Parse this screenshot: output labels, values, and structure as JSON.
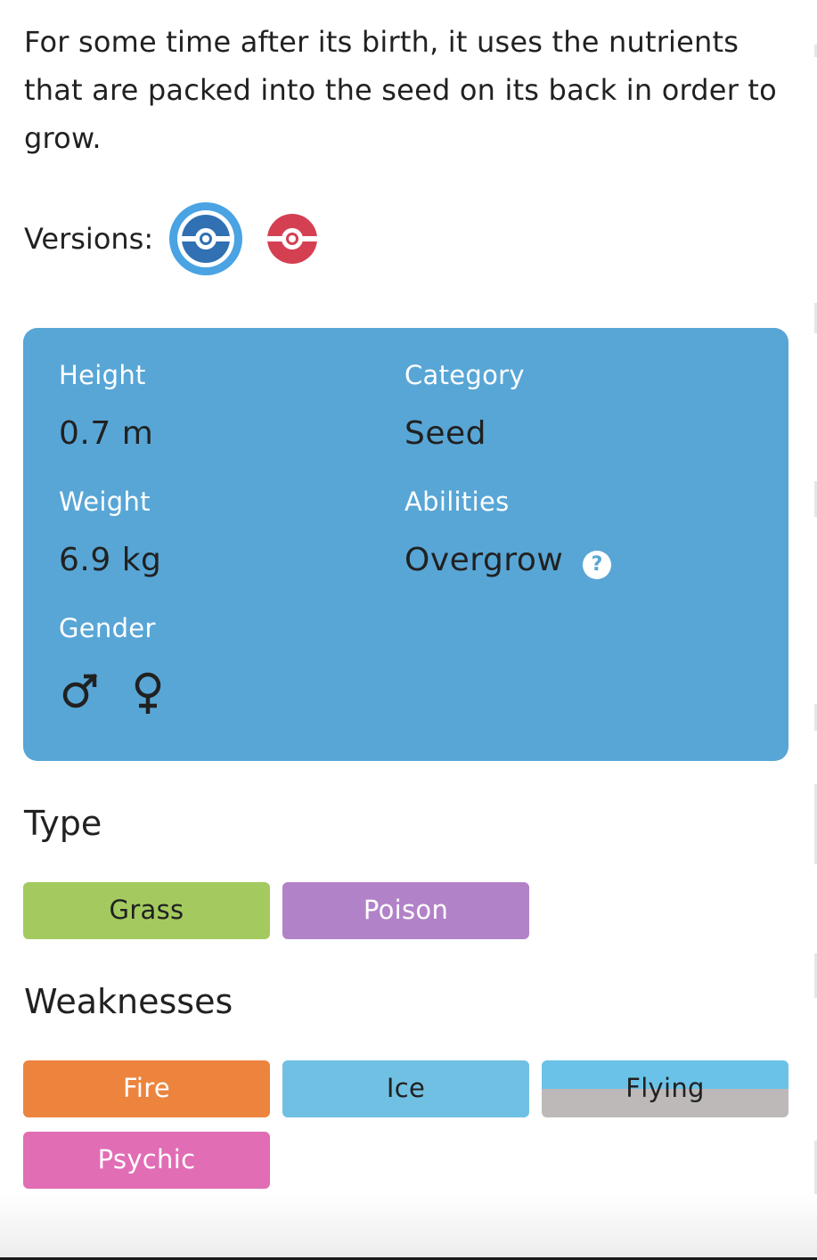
{
  "description": "For some time after its birth, it uses the nutrients that are packed into the seed on its back in order to grow.",
  "versions": {
    "label": "Versions:",
    "items": [
      {
        "name": "pokeball-blue-icon",
        "color": "#3070b3",
        "selected": true
      },
      {
        "name": "pokeball-red-icon",
        "color": "#d44052",
        "selected": false
      }
    ]
  },
  "info": {
    "height": {
      "label": "Height",
      "value": "0.7 m"
    },
    "weight": {
      "label": "Weight",
      "value": "6.9 kg"
    },
    "gender": {
      "label": "Gender",
      "icons": [
        "male-icon",
        "female-icon"
      ]
    },
    "category": {
      "label": "Category",
      "value": "Seed"
    },
    "abilities": {
      "label": "Abilities",
      "value": "Overgrow",
      "help_icon": "?"
    },
    "background_color": "#58a6d6"
  },
  "type": {
    "title": "Type",
    "items": [
      {
        "label": "Grass",
        "color": "#9bcc50",
        "text_color": "#212121"
      },
      {
        "label": "Poison",
        "color": "#b97fc9",
        "text_color": "#ffffff"
      }
    ]
  },
  "weaknesses": {
    "title": "Weaknesses",
    "items": [
      {
        "label": "Fire",
        "color": "#fd7d24",
        "text_color": "#ffffff"
      },
      {
        "label": "Ice",
        "color": "#51c4e7",
        "text_color": "#212121"
      },
      {
        "label": "Flying",
        "colors": [
          "#3dc7ef",
          "#bdb9b8"
        ],
        "text_color": "#212121"
      },
      {
        "label": "Psychic",
        "color": "#f366b9",
        "text_color": "#ffffff"
      }
    ]
  }
}
